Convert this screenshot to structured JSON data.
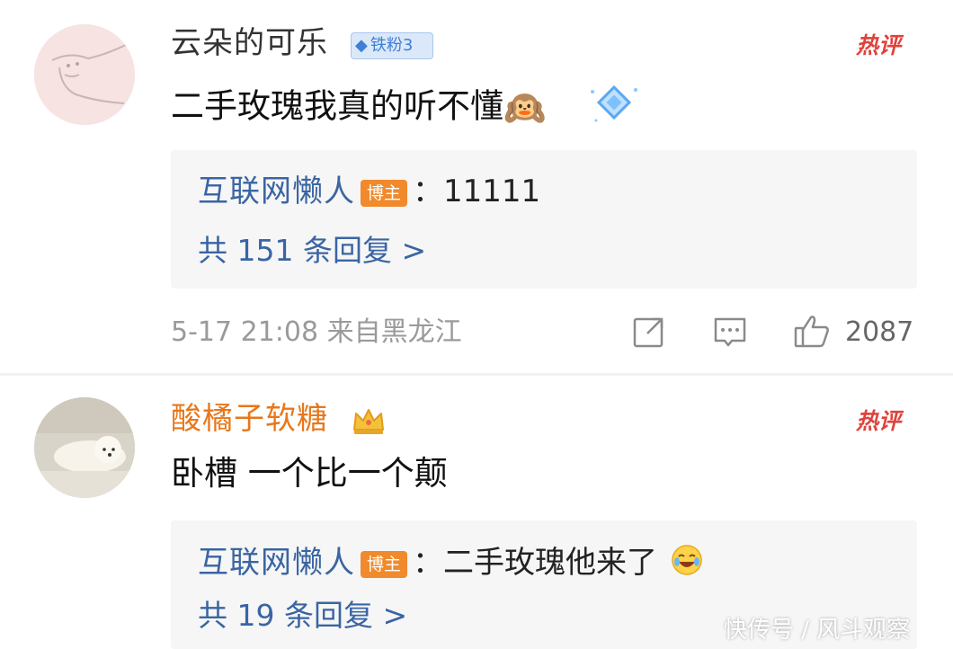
{
  "comments": [
    {
      "username": "云朵的可乐",
      "badge": {
        "icon": "diamond-icon",
        "label": "铁粉3"
      },
      "hot_label": "热评",
      "content": "二手玫瑰我真的听不懂",
      "content_emoji": "🙉",
      "reply": {
        "author": "互联网懒人",
        "author_badge": "博主",
        "text": "：11111",
        "more": "共 151 条回复 >"
      },
      "meta": "5-17 21:08  来自黑龙江",
      "actions": {
        "share_icon": "share-icon",
        "comment_icon": "comment-icon",
        "like_icon": "thumbs-up-icon",
        "like_count": "2087"
      }
    },
    {
      "username": "酸橘子软糖",
      "badge": {
        "icon": "crown-icon"
      },
      "hot_label": "热评",
      "content": "卧槽 一个比一个颠",
      "reply": {
        "author": "互联网懒人",
        "author_badge": "博主",
        "text": "：二手玫瑰他来了",
        "more": "共 19 条回复 >"
      }
    }
  ],
  "watermark": "快传号 / 风斗观察",
  "colors": {
    "link_blue": "#3a65a3",
    "hot_red": "#e0423c",
    "vip_orange": "#e8771b",
    "blogger_badge": "#f08a2c",
    "reply_bg": "#f6f6f6",
    "meta_gray": "#9a9a9a"
  }
}
